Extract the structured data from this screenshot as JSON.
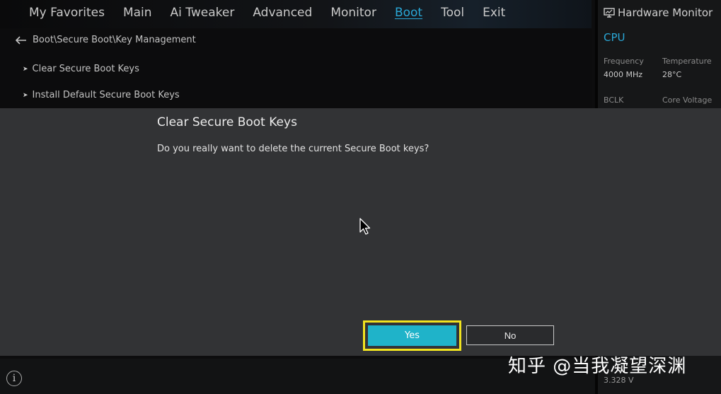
{
  "nav": {
    "tabs": [
      {
        "label": "My Favorites"
      },
      {
        "label": "Main"
      },
      {
        "label": "Ai Tweaker"
      },
      {
        "label": "Advanced"
      },
      {
        "label": "Monitor"
      },
      {
        "label": "Boot"
      },
      {
        "label": "Tool"
      },
      {
        "label": "Exit"
      }
    ],
    "active": "Boot"
  },
  "breadcrumb": "Boot\\Secure Boot\\Key Management",
  "menu": {
    "items": [
      {
        "label": "Clear Secure Boot Keys"
      },
      {
        "label": "Install Default Secure Boot Keys"
      }
    ]
  },
  "hardware_monitor": {
    "title": "Hardware Monitor",
    "section": "CPU",
    "frequency_label": "Frequency",
    "frequency_value": "4000 MHz",
    "temperature_label": "Temperature",
    "temperature_value": "28°C",
    "bclk_label": "BCLK",
    "core_voltage_label": "Core Voltage",
    "bottom_value": "3.328 V"
  },
  "dialog": {
    "title": "Clear Secure Boot Keys",
    "message": "Do you really want to delete the current Secure Boot keys?",
    "yes_label": "Yes",
    "no_label": "No"
  },
  "info_icon_glyph": "i",
  "watermark": "知乎 @当我凝望深渊",
  "colors": {
    "accent": "#2aa7d6",
    "yes_button": "#1fb3c9",
    "focus_border": "#f1e31f",
    "dialog_bg": "#323335"
  },
  "icons": [
    "back-arrow-icon",
    "monitor-icon",
    "info-icon",
    "mouse-cursor-icon"
  ]
}
